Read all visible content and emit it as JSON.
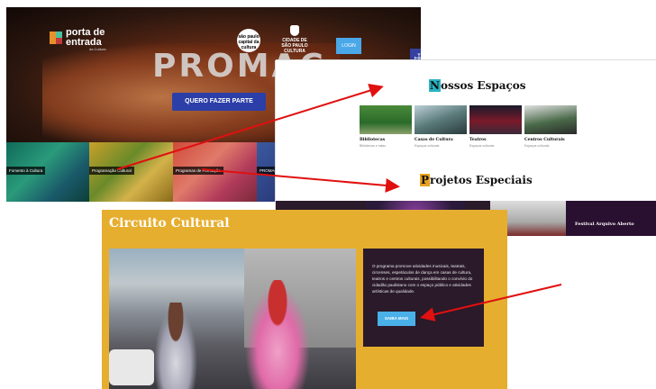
{
  "hero": {
    "logo": {
      "line1": "porta de",
      "line2": "entrada",
      "sub": "da Cultura"
    },
    "banner_word": "PROMAC",
    "partner_badge": "são paulo capital da cultura",
    "city_logo": {
      "line1": "CIDADE DE",
      "line2": "SÃO PAULO",
      "line3": "CULTURA"
    },
    "login_button": "LOGIN",
    "cta_button": "QUERO FAZER PARTE",
    "accessibility_icon": "accessibility-icon"
  },
  "categories": [
    {
      "label": "Fomento à Cultura"
    },
    {
      "label": "Programação Cultural"
    },
    {
      "label": "Programas de Formação"
    },
    {
      "label": "PROMAC"
    }
  ],
  "spaces_panel": {
    "title_first": "N",
    "title_rest": "ossos Espaços",
    "cards": [
      {
        "title": "Bibliotecas",
        "sub": "Bibliotecas e salas"
      },
      {
        "title": "Casas de Cultura",
        "sub": "Espaços culturais"
      },
      {
        "title": "Teatros",
        "sub": "Espaços culturais"
      },
      {
        "title": "Centros Culturais",
        "sub": "Espaços culturais"
      }
    ],
    "projects_first": "P",
    "projects_rest": "rojetos Especiais",
    "festival_label": "Festival Arquivo Aberto"
  },
  "circuito": {
    "title": "Circuito Cultural",
    "description": "O programa promove atividades musicais, teatrais, circenses, espetáculos de dança em casas de cultura, teatros e centros culturais, possibilitando o convívio do cidadão paulistano com o espaço público e atividades artísticas de qualidade.",
    "button": "SAIBA MAIS"
  },
  "colors": {
    "arrow": "#e01010",
    "accent_teal": "#2ab3c4",
    "accent_orange": "#e8a020",
    "circuito_bg": "#e6ae2e",
    "button_blue": "#4ab0e8"
  }
}
